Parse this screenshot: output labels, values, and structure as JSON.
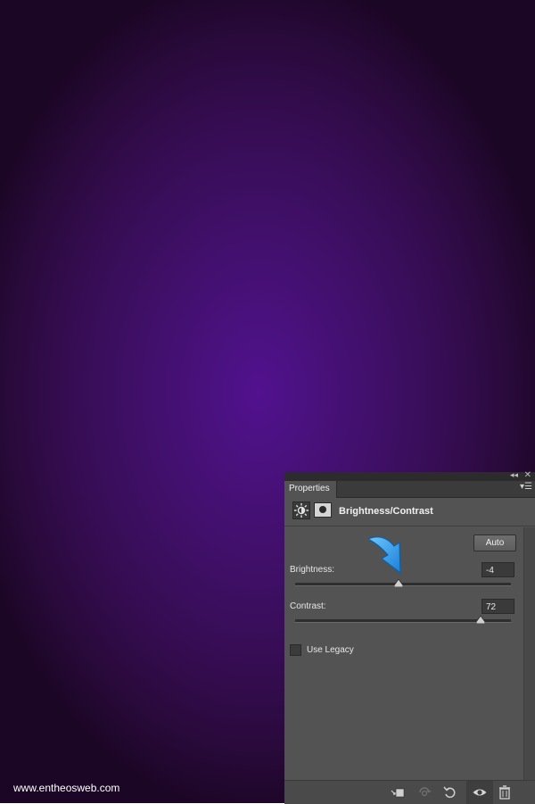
{
  "watermark": "www.entheosweb.com",
  "panel": {
    "tab": "Properties",
    "title": "Brightness/Contrast",
    "auto_label": "Auto",
    "brightness": {
      "label": "Brightness:",
      "value": "-4",
      "slider_fraction": 0.48
    },
    "contrast": {
      "label": "Contrast:",
      "value": "72",
      "slider_fraction": 0.86
    },
    "legacy": {
      "label": "Use Legacy",
      "checked": false
    }
  },
  "colors": {
    "canvas_center": "#52118f",
    "canvas_edge": "#1c0626",
    "panel_bg": "#535353",
    "arrow": "#2a9be8"
  },
  "icons": {
    "adjustment": "brightness-contrast-icon",
    "mask": "layer-mask-icon",
    "arrow": "blue-pointer-arrow"
  }
}
